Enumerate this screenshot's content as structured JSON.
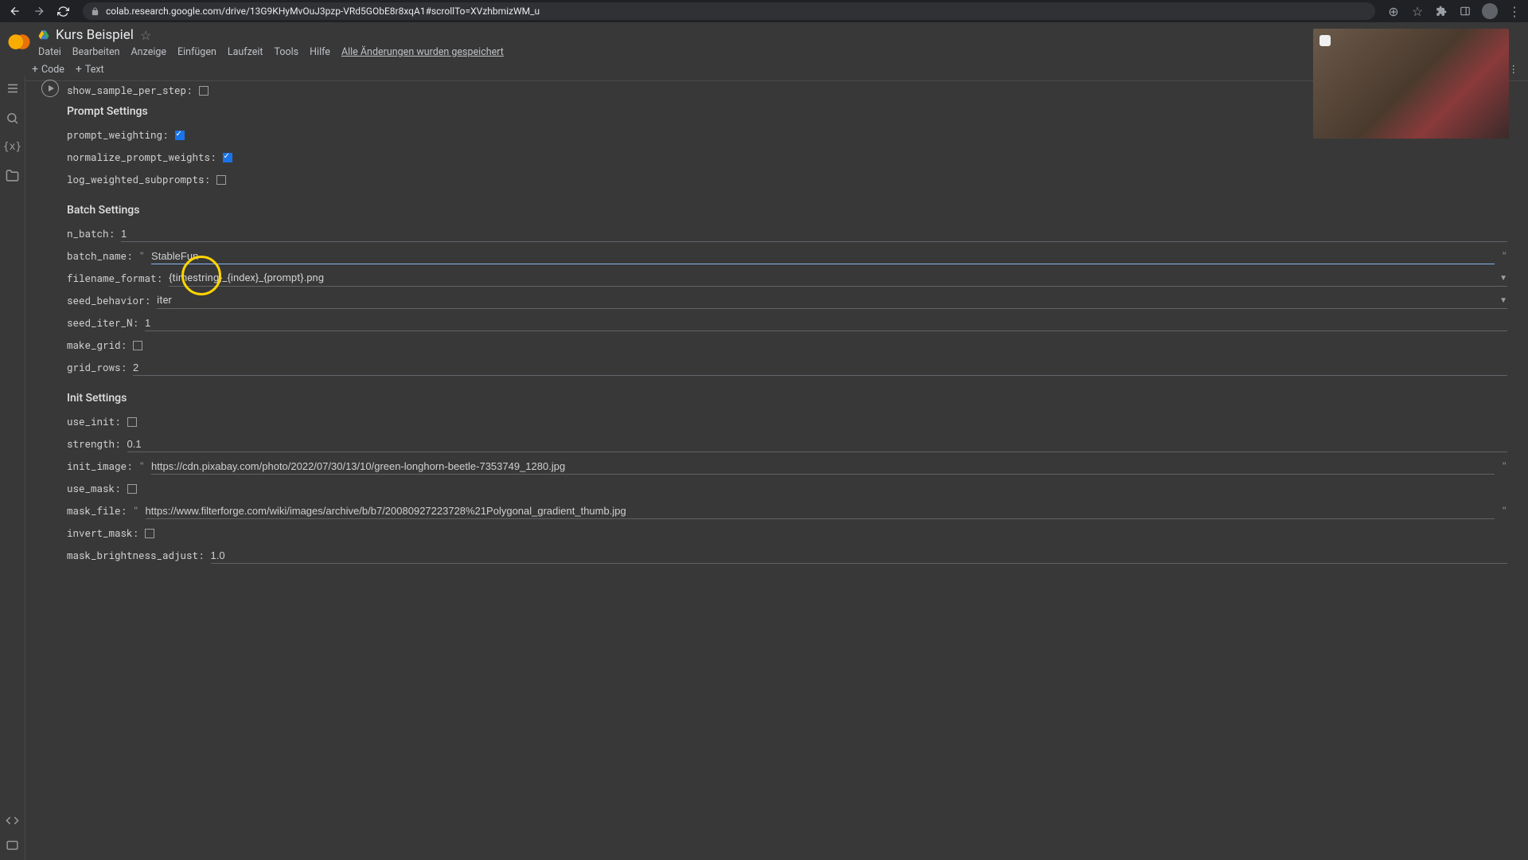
{
  "browser": {
    "url": "colab.research.google.com/drive/13G9KHyMvOuJ3pzp-VRd5GObE8r8xqA1#scrollTo=XVzhbmizWM_u"
  },
  "notebook": {
    "title": "Kurs Beispiel",
    "menus": [
      "Datei",
      "Bearbeiten",
      "Anzeige",
      "Einfügen",
      "Laufzeit",
      "Tools",
      "Hilfe"
    ],
    "save_status": "Alle Änderungen wurden gespeichert",
    "toolbar": {
      "code": "Code",
      "text": "Text"
    }
  },
  "form": {
    "show_sample_per_step": {
      "label": "show_sample_per_step:",
      "checked": false
    },
    "section_prompt": "Prompt Settings",
    "prompt_weighting": {
      "label": "prompt_weighting:",
      "checked": true
    },
    "normalize_prompt_weights": {
      "label": "normalize_prompt_weights:",
      "checked": true
    },
    "log_weighted_subprompts": {
      "label": "log_weighted_subprompts:",
      "checked": false
    },
    "section_batch": "Batch Settings",
    "n_batch": {
      "label": "n_batch:",
      "value": "1"
    },
    "batch_name": {
      "label": "batch_name:",
      "value": "StableFun"
    },
    "filename_format": {
      "label": "filename_format:",
      "value": "{timestring}_{index}_{prompt}.png"
    },
    "seed_behavior": {
      "label": "seed_behavior:",
      "value": "iter"
    },
    "seed_iter_N": {
      "label": "seed_iter_N:",
      "value": "1"
    },
    "make_grid": {
      "label": "make_grid:",
      "checked": false
    },
    "grid_rows": {
      "label": "grid_rows:",
      "value": "2"
    },
    "section_init": "Init Settings",
    "use_init": {
      "label": "use_init:",
      "checked": false
    },
    "strength": {
      "label": "strength:",
      "value": "0.1"
    },
    "init_image": {
      "label": "init_image:",
      "value": "https://cdn.pixabay.com/photo/2022/07/30/13/10/green-longhorn-beetle-7353749_1280.jpg"
    },
    "use_mask": {
      "label": "use_mask:",
      "checked": false
    },
    "mask_file": {
      "label": "mask_file:",
      "value": "https://www.filterforge.com/wiki/images/archive/b/b7/20080927223728%21Polygonal_gradient_thumb.jpg"
    },
    "invert_mask": {
      "label": "invert_mask:",
      "checked": false
    },
    "mask_brightness_adjust": {
      "label": "mask_brightness_adjust:",
      "value": "1.0"
    }
  }
}
